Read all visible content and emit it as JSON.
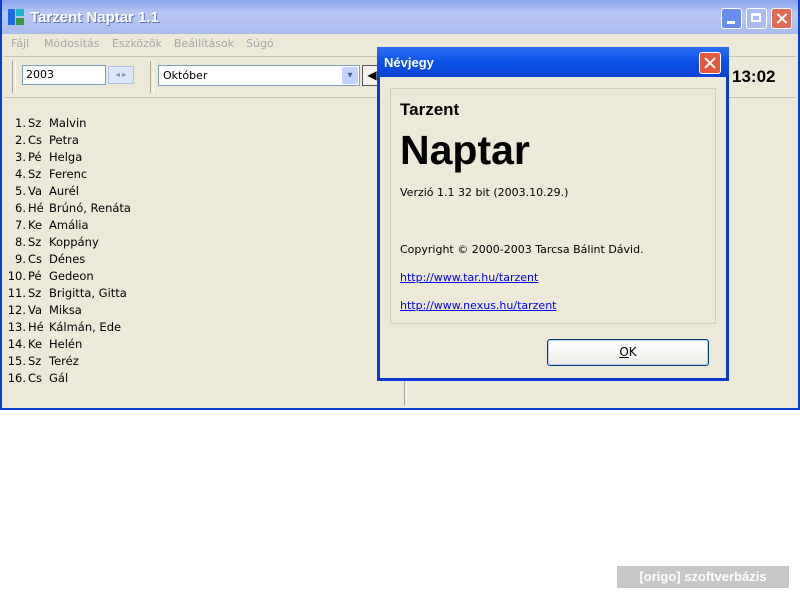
{
  "window": {
    "title": "Tarzent Naptar 1.1",
    "menu": [
      "Fájl",
      "Módosítás",
      "Eszközök",
      "Beállítások",
      "Súgó"
    ]
  },
  "toolbar": {
    "year": "2003",
    "spin": "◂ ▸",
    "month": "Október",
    "dropdown_glyph": "▾",
    "prev_glyph": "◀",
    "clock": "13:02"
  },
  "name_days": [
    {
      "num": "1.",
      "day": "Sz",
      "names": "Malvin"
    },
    {
      "num": "2.",
      "day": "Cs",
      "names": "Petra"
    },
    {
      "num": "3.",
      "day": "Pé",
      "names": "Helga"
    },
    {
      "num": "4.",
      "day": "Sz",
      "names": "Ferenc"
    },
    {
      "num": "5.",
      "day": "Va",
      "names": "Aurél"
    },
    {
      "num": "6.",
      "day": "Hé",
      "names": "Brúnó, Renáta"
    },
    {
      "num": "7.",
      "day": "Ke",
      "names": "Amália"
    },
    {
      "num": "8.",
      "day": "Sz",
      "names": "Koppány"
    },
    {
      "num": "9.",
      "day": "Cs",
      "names": "Dénes"
    },
    {
      "num": "10.",
      "day": "Pé",
      "names": "Gedeon"
    },
    {
      "num": "11.",
      "day": "Sz",
      "names": "Brigitta, Gitta"
    },
    {
      "num": "12.",
      "day": "Va",
      "names": "Miksa"
    },
    {
      "num": "13.",
      "day": "Hé",
      "names": "Kálmán, Ede"
    },
    {
      "num": "14.",
      "day": "Ke",
      "names": "Helén"
    },
    {
      "num": "15.",
      "day": "Sz",
      "names": "Teréz"
    },
    {
      "num": "16.",
      "day": "Cs",
      "names": "Gál"
    }
  ],
  "dialog": {
    "title": "Névjegy",
    "brand": "Tarzent",
    "product": "Naptar",
    "version": "Verzió 1.1 32 bit (2003.10.29.)",
    "copyright": "Copyright © 2000-2003 Tarcsa  Bálint Dávid.",
    "link1": "http://www.tar.hu/tarzent",
    "link2": "http://www.nexus.hu/tarzent",
    "ok_underlined": "O",
    "ok_rest": "K"
  },
  "watermark": "[origo] szoftverbázis"
}
